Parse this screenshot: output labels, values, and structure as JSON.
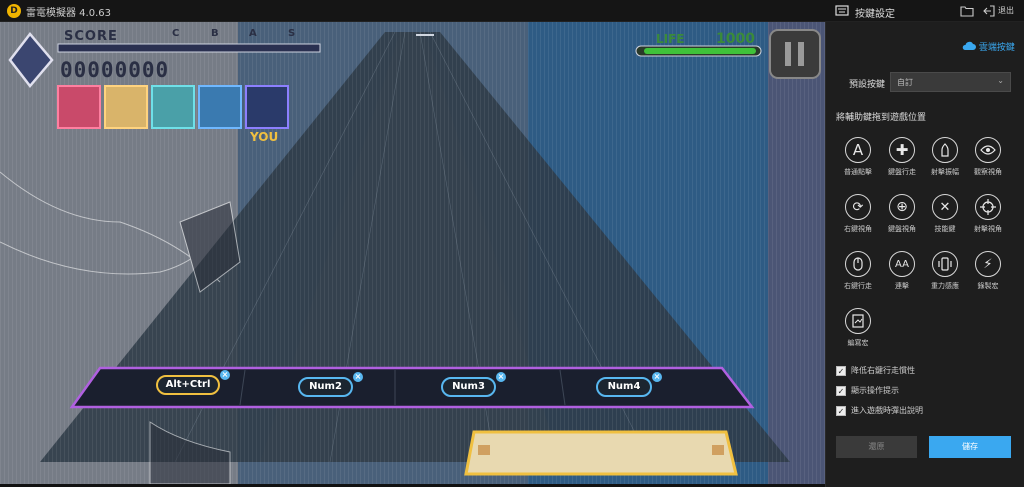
{
  "app": {
    "title": "雷電模擬器 4.0.63",
    "logo_letter": "D"
  },
  "titlebar": {
    "icons": [
      "keyboard-icon",
      "folder-icon",
      "exit-icon"
    ],
    "settings_label": "按鍵設定",
    "exit_label": "退出"
  },
  "game": {
    "score_label": "SCORE",
    "score_value": "00000000",
    "grades": [
      "C",
      "B",
      "A",
      "S"
    ],
    "life_label": "LIFE",
    "life_value": "1000",
    "you_label": "YOU",
    "lane_keys": [
      {
        "label": "Alt+Ctrl",
        "active": true
      },
      {
        "label": "Num2",
        "active": false
      },
      {
        "label": "Num3",
        "active": false
      },
      {
        "label": "Num4",
        "active": false
      }
    ],
    "colors": {
      "lane_border": "#b060e0",
      "key_chip_border": "#58b7f0",
      "active_chip_border": "#f0c040",
      "life_green": "#3fc23a"
    }
  },
  "panel": {
    "cloud_label": "雲端按鍵",
    "preset_label": "預設按鍵",
    "preset_value": "自訂",
    "section_title": "將輔助鍵拖到遊戲位置",
    "tools": [
      {
        "label": "普通點擊",
        "icon": "letter-a-icon",
        "glyph": "A"
      },
      {
        "label": "鍵盤行走",
        "icon": "dpad-icon",
        "glyph": "✚"
      },
      {
        "label": "射擊振幅",
        "icon": "bullet-icon",
        "glyph": "❘"
      },
      {
        "label": "觀察視角",
        "icon": "eye-icon",
        "glyph": "◉"
      },
      {
        "label": "右鍵視角",
        "icon": "rotate-view-icon",
        "glyph": "⟳"
      },
      {
        "label": "鍵盤視角",
        "icon": "keyboard-view-icon",
        "glyph": "⊕"
      },
      {
        "label": "技能鍵",
        "icon": "skill-swords-icon",
        "glyph": "✕"
      },
      {
        "label": "射擊視角",
        "icon": "crosshair-icon",
        "glyph": "⊕"
      },
      {
        "label": "右鍵行走",
        "icon": "mouse-icon",
        "glyph": "▯"
      },
      {
        "label": "連擊",
        "icon": "double-a-icon",
        "glyph": "AA"
      },
      {
        "label": "重力感應",
        "icon": "phone-tilt-icon",
        "glyph": "▯"
      },
      {
        "label": "錄製宏",
        "icon": "lightning-icon",
        "glyph": "⚡"
      },
      {
        "label": "編寫宏",
        "icon": "script-icon",
        "glyph": "✎"
      }
    ],
    "checkboxes": [
      {
        "label": "降低右鍵行走慣性",
        "checked": true
      },
      {
        "label": "顯示操作提示",
        "checked": true
      },
      {
        "label": "進入遊戲時彈出說明",
        "checked": true
      }
    ],
    "reset_label": "還原",
    "save_label": "儲存",
    "colors": {
      "accent": "#3aa8f0"
    }
  }
}
